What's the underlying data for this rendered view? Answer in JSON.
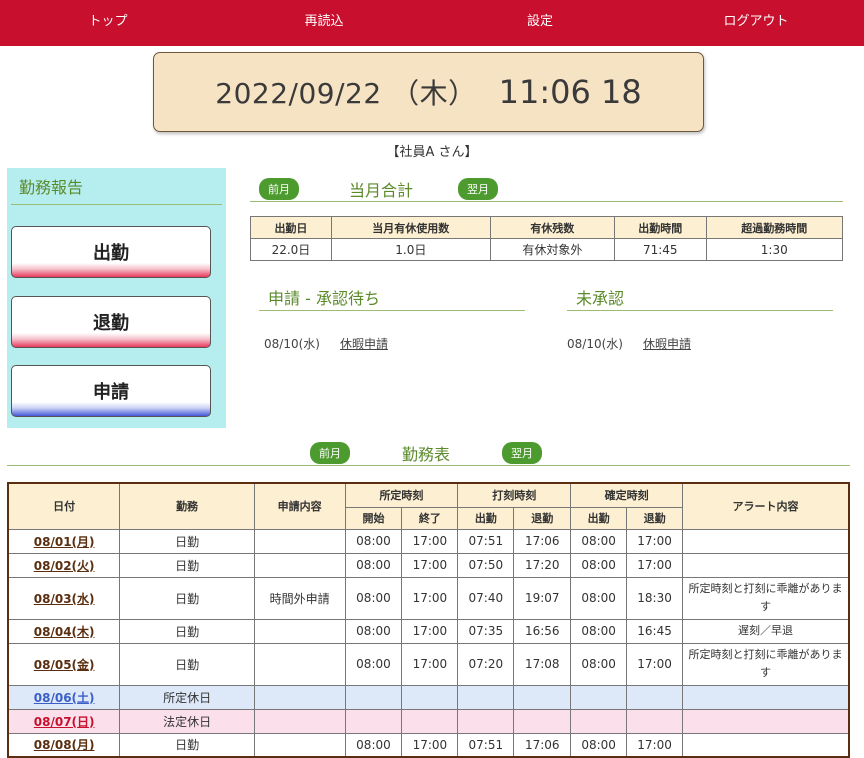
{
  "nav": [
    "トップ",
    "再読込",
    "設定",
    "ログアウト"
  ],
  "clock": {
    "date": "2022/09/22 （木）",
    "time": "11:06 18"
  },
  "user_label": "【社員A さん】",
  "report": {
    "title": "勤務報告",
    "buttons": [
      "出勤",
      "退勤",
      "申請"
    ]
  },
  "monthly": {
    "prev": "前月",
    "next": "翌月",
    "title": "当月合計",
    "headers": [
      "出勤日",
      "当月有休使用数",
      "有休残数",
      "出勤時間",
      "超過勤務時間"
    ],
    "values": [
      "22.0日",
      "1.0日",
      "有休対象外",
      "71:45",
      "1:30"
    ]
  },
  "pending": {
    "title": "申請 - 承認待ち",
    "date": "08/10(水)",
    "link": "休暇申請"
  },
  "unapproved": {
    "title": "未承認",
    "date": "08/10(水)",
    "link": "休暇申請"
  },
  "worktable": {
    "prev": "前月",
    "next": "翌月",
    "title": "勤務表",
    "headers": {
      "date": "日付",
      "work": "勤務",
      "request": "申請内容",
      "scheduled": "所定時刻",
      "stamped": "打刻時刻",
      "confirmed": "確定時刻",
      "alert": "アラート内容",
      "start": "開始",
      "end": "終了",
      "in": "出勤",
      "out": "退勤"
    },
    "rows": [
      {
        "date": "08/01(月)",
        "work": "日勤",
        "request": "",
        "s_start": "08:00",
        "s_end": "17:00",
        "p_in": "07:51",
        "p_out": "17:06",
        "c_in": "08:00",
        "c_out": "17:00",
        "alert": ""
      },
      {
        "date": "08/02(火)",
        "work": "日勤",
        "request": "",
        "s_start": "08:00",
        "s_end": "17:00",
        "p_in": "07:50",
        "p_out": "17:20",
        "c_in": "08:00",
        "c_out": "17:00",
        "alert": ""
      },
      {
        "date": "08/03(水)",
        "work": "日勤",
        "request": "時間外申請",
        "s_start": "08:00",
        "s_end": "17:00",
        "p_in": "07:40",
        "p_out": "19:07",
        "c_in": "08:00",
        "c_out": "18:30",
        "alert": "所定時刻と打刻に乖離があります"
      },
      {
        "date": "08/04(木)",
        "work": "日勤",
        "request": "",
        "s_start": "08:00",
        "s_end": "17:00",
        "p_in": "07:35",
        "p_out": "16:56",
        "c_in": "08:00",
        "c_out": "16:45",
        "alert": "遅刻／早退"
      },
      {
        "date": "08/05(金)",
        "work": "日勤",
        "request": "",
        "s_start": "08:00",
        "s_end": "17:00",
        "p_in": "07:20",
        "p_out": "17:08",
        "c_in": "08:00",
        "c_out": "17:00",
        "alert": "所定時刻と打刻に乖離があります"
      },
      {
        "date": "08/06(土)",
        "work": "所定休日",
        "request": "",
        "s_start": "",
        "s_end": "",
        "p_in": "",
        "p_out": "",
        "c_in": "",
        "c_out": "",
        "alert": ""
      },
      {
        "date": "08/07(日)",
        "work": "法定休日",
        "request": "",
        "s_start": "",
        "s_end": "",
        "p_in": "",
        "p_out": "",
        "c_in": "",
        "c_out": "",
        "alert": ""
      },
      {
        "date": "08/08(月)",
        "work": "日勤",
        "request": "",
        "s_start": "08:00",
        "s_end": "17:00",
        "p_in": "07:51",
        "p_out": "17:06",
        "c_in": "08:00",
        "c_out": "17:00",
        "alert": ""
      }
    ]
  }
}
